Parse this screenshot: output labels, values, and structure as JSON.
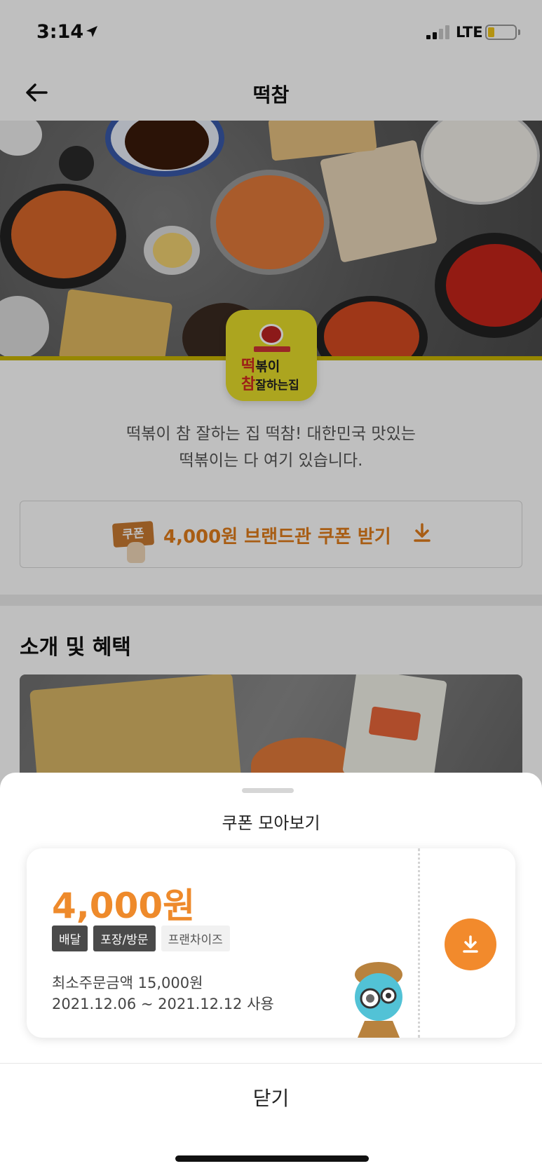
{
  "status_bar": {
    "time": "3:14",
    "network": "LTE",
    "battery_color": "#f0c419"
  },
  "nav": {
    "title": "떡참",
    "back_icon": "arrow-left-icon"
  },
  "brand": {
    "logo_line1_accent": "떡",
    "logo_line1_rest": "볶이",
    "logo_line2_accent": "참",
    "logo_line2_rest": "잘하는집",
    "description_line1": "떡볶이 참 잘하는 집 떡참! 대한민국 맛있는",
    "description_line2": "떡볶이는 다 여기 있습니다."
  },
  "coupon_banner": {
    "tag": "쿠폰",
    "label": "4,000원 브랜드관 쿠폰 받기",
    "icon": "download-icon",
    "accent": "#e07c1b"
  },
  "section": {
    "title": "소개 및 혜택"
  },
  "sheet": {
    "title": "쿠폰 모아보기",
    "coupon": {
      "amount": "4,000원",
      "chips": [
        "배달",
        "포장/방문",
        "프랜차이즈"
      ],
      "min_order": "최소주문금액 15,000원",
      "period": "2021.12.06 ~ 2021.12.12 사용",
      "download_icon": "download-icon",
      "accent": "#f28a2c"
    },
    "close_label": "닫기"
  }
}
